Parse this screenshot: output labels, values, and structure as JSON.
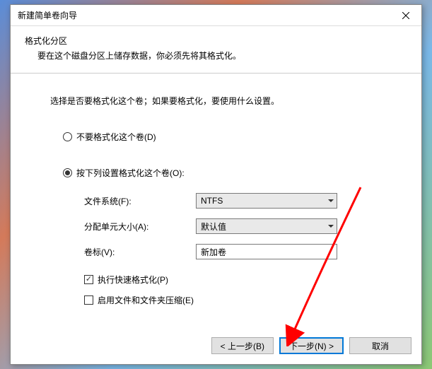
{
  "window": {
    "title": "新建简单卷向导"
  },
  "header": {
    "title": "格式化分区",
    "desc": "要在这个磁盘分区上储存数据，你必须先将其格式化。"
  },
  "content": {
    "instruction": "选择是否要格式化这个卷；如果要格式化，要使用什么设置。",
    "radio_no_format": "不要格式化这个卷(D)",
    "radio_format": "按下列设置格式化这个卷(O):",
    "filesystem_label": "文件系统(F):",
    "filesystem_value": "NTFS",
    "alloc_label": "分配单元大小(A):",
    "alloc_value": "默认值",
    "volume_label": "卷标(V):",
    "volume_value": "新加卷",
    "quick_format": "执行快速格式化(P)",
    "compression": "启用文件和文件夹压缩(E)"
  },
  "footer": {
    "back": "< 上一步(B)",
    "next": "下一步(N) >",
    "cancel": "取消"
  }
}
